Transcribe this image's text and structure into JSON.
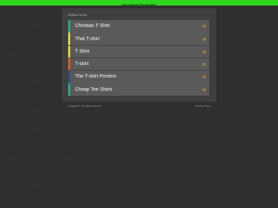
{
  "banner": {
    "text": "Interested in this domain?"
  },
  "panel": {
    "heading": "Related Links",
    "links": [
      {
        "label": "Christian T Shirt",
        "accent": "#2aa88a",
        "arrow": "»"
      },
      {
        "label": "That T-shirt",
        "accent": "#e0d63b",
        "arrow": "»"
      },
      {
        "label": "T Shirt",
        "accent": "#e0d63b",
        "arrow": "»"
      },
      {
        "label": "T-shirt",
        "accent": "#e05a2b",
        "arrow": "»"
      },
      {
        "label": "The T-shirt Printers",
        "accent": "#2a4f8a",
        "arrow": "»"
      },
      {
        "label": "Cheap Tee Shirts",
        "accent": "#2aa88a",
        "arrow": "»"
      }
    ]
  },
  "footer": {
    "copyright": "Copyright ©. All rights reserved.",
    "privacy": "Privacy Policy"
  },
  "colors": {
    "banner": "#2fd61f",
    "background": "#333333",
    "panel": "#3f3f3f",
    "row": "#5a5a5a",
    "arrow": "#f39a1b"
  }
}
